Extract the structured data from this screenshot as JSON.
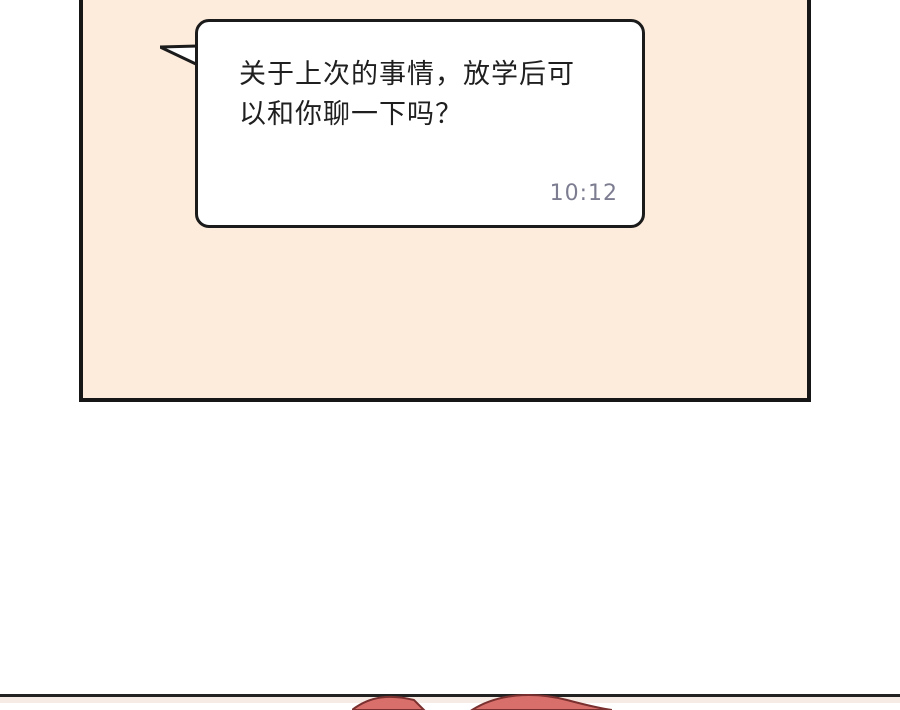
{
  "message": {
    "text": "关于上次的事情，放学后可以和你聊一下吗？",
    "time": "10:12"
  },
  "colors": {
    "panel_background": "#fdebdb",
    "bubble_background": "#ffffff",
    "border": "#161616",
    "message_text": "#1f1f1f",
    "timestamp_text": "#7d7d92",
    "hair": "#d86f6a"
  }
}
